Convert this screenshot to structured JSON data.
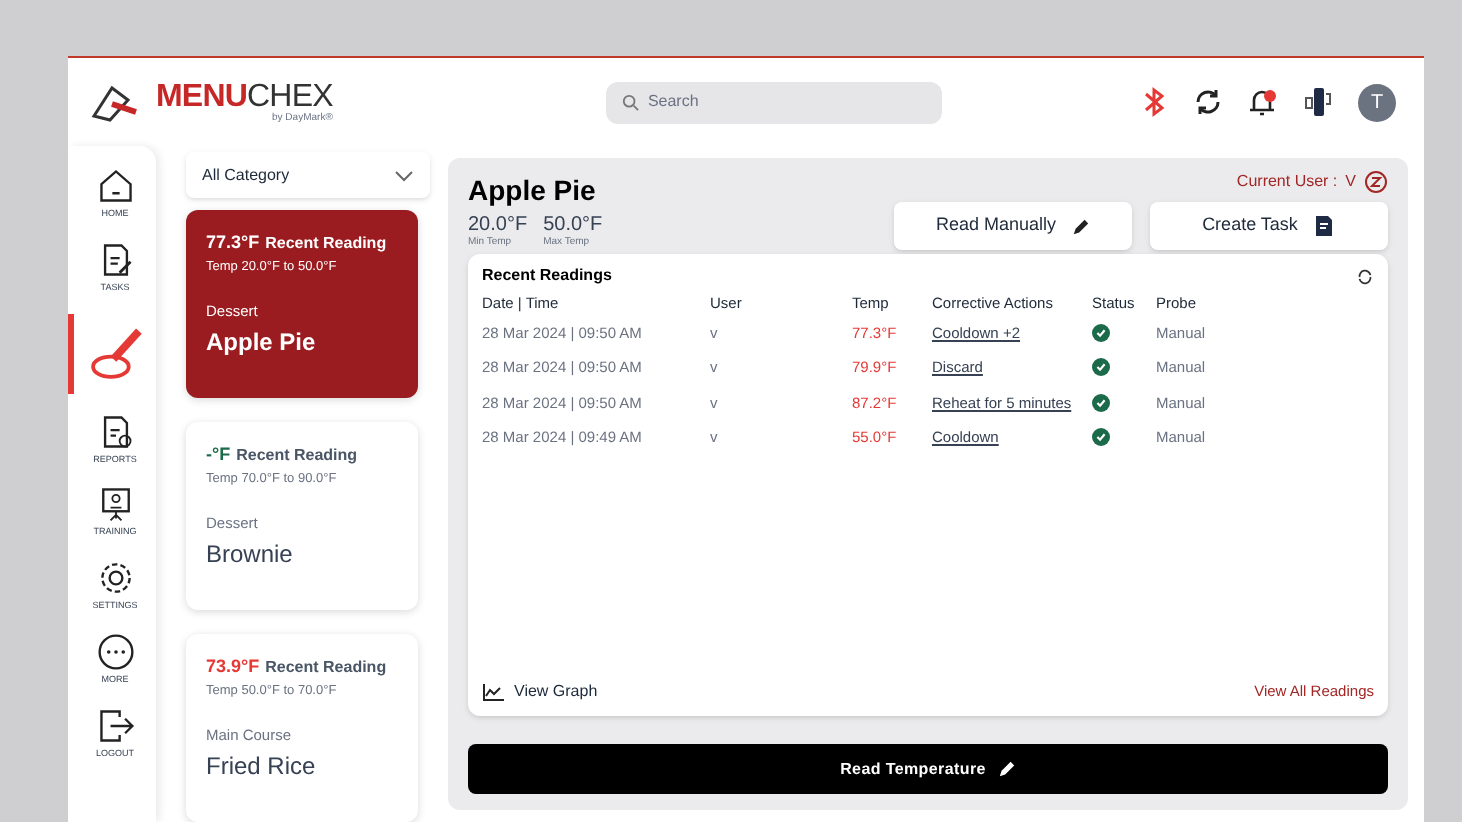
{
  "header": {
    "brand": [
      "MENU",
      "CHEX"
    ],
    "tagline": "by DayMark®",
    "search": {
      "placeholder": "Search"
    },
    "notification_unread": true,
    "avatar": "T"
  },
  "nav": [
    {
      "label": "HOME",
      "kind": "home",
      "selected": false
    },
    {
      "label": "TASKS",
      "kind": "tasks",
      "selected": false
    },
    {
      "kind": "probe",
      "selected": true
    },
    {
      "label": "REPORTS",
      "kind": "reports",
      "selected": false
    },
    {
      "label": "TRAINING",
      "kind": "training",
      "selected": false
    },
    {
      "label": "SETTINGS",
      "kind": "settings",
      "selected": false
    },
    {
      "label": "MORE",
      "kind": "more",
      "selected": false
    },
    {
      "label": "LOGOUT",
      "kind": "logout",
      "selected": false
    }
  ],
  "category_filter": {
    "value": "All Category"
  },
  "items": [
    {
      "reading": "77.3°F",
      "reading_label": "Recent Reading",
      "range": "Temp 20.0°F to 50.0°F",
      "category": "Dessert",
      "name": "Apple Pie",
      "selected": true
    },
    {
      "reading": "-°F",
      "reading_label": "Recent Reading",
      "range": "Temp 70.0°F to 90.0°F",
      "category": "Dessert",
      "name": "Brownie",
      "out_of_range": false,
      "selected": false
    },
    {
      "reading": "73.9°F",
      "reading_label": "Recent Reading",
      "range": "Temp 50.0°F to 70.0°F",
      "category": "Main Course",
      "name": "Fried Rice",
      "out_of_range": true,
      "selected": false
    }
  ],
  "detail": {
    "title": "Apple Pie",
    "min_temp": "20.0°F",
    "min_label": "Min Temp",
    "max_temp": "50.0°F",
    "max_label": "Max Temp",
    "current_user_label": "Current User :",
    "current_user": "V",
    "buttons": [
      "Read Manually",
      "Create Task"
    ],
    "readings": {
      "title": "Recent Readings",
      "columns": [
        "Date | Time",
        "User",
        "Temp",
        "Corrective Actions",
        "Status",
        "Probe"
      ],
      "rows": [
        {
          "datetime": "28 Mar 2024 | 09:50 AM",
          "user": "v",
          "temp": "77.3°F",
          "action": "Cooldown +2",
          "ok": true,
          "probe": "Manual"
        },
        {
          "datetime": "28 Mar 2024 | 09:50 AM",
          "user": "v",
          "temp": "79.9°F",
          "action": "Discard",
          "ok": true,
          "probe": "Manual"
        },
        {
          "datetime": "28 Mar 2024 | 09:50 AM",
          "user": "v",
          "temp": "87.2°F",
          "action": "Reheat for 5 minutes",
          "ok": true,
          "probe": "Manual"
        },
        {
          "datetime": "28 Mar 2024 | 09:49 AM",
          "user": "v",
          "temp": "55.0°F",
          "action": "Cooldown",
          "ok": true,
          "probe": "Manual"
        }
      ],
      "view_graph": "View Graph",
      "view_all": "View All Readings"
    },
    "primary_button": "Read Temperature"
  }
}
